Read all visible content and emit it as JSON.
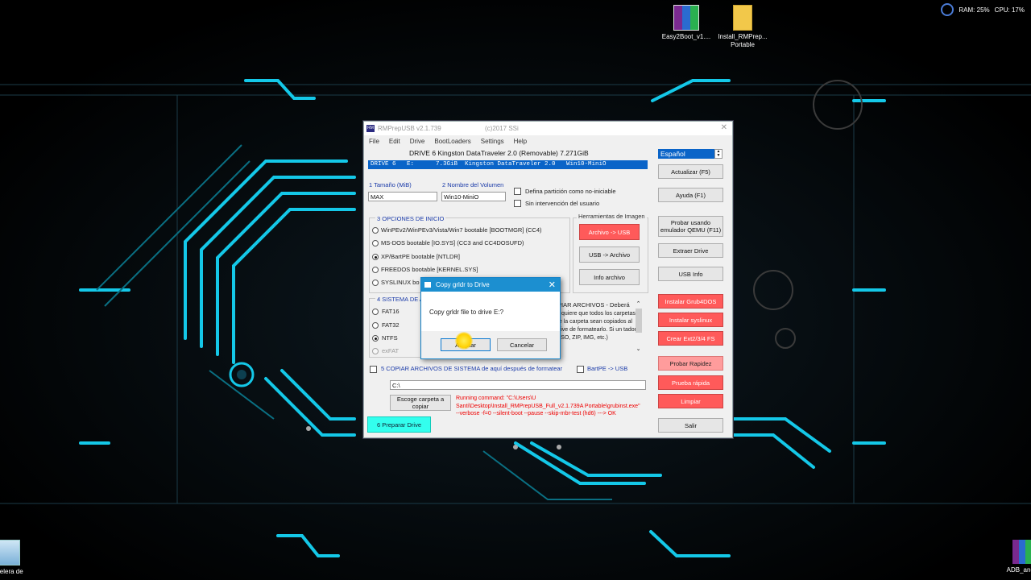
{
  "desktop": {
    "icons": [
      {
        "label": "Easy2Boot_v1...."
      },
      {
        "label": "Install_RMPrep... Portable"
      },
      {
        "label": "pelera de"
      },
      {
        "label": "ADB_and_"
      }
    ],
    "sysmon": {
      "ram": "RAM: 25%",
      "cpu": "CPU: 17%"
    }
  },
  "window": {
    "title": "RMPrepUSB v2.1.739",
    "copyright": "(c)2017 SSi",
    "menu": [
      "File",
      "Edit",
      "Drive",
      "BootLoaders",
      "Settings",
      "Help"
    ],
    "drive_title": "DRIVE 6 Kingston DataTraveler 2.0  (Removable) 7.271GiB",
    "drive_row": "DRIVE 6   E:      7.3GiB  Kingston DataTraveler 2.0   Win10-MiniO",
    "language": "Español",
    "size_label": "1 Tamaño (MiB)",
    "size_value": "MAX",
    "volname_label": "2 Nombre del Volumen",
    "volname_value": "Win10-MiniO",
    "chk_partition": "Defina partición como no-iniciable",
    "chk_nouser": "Sin intervención del usuario",
    "boot_options_label": "3 OPCIONES DE INICIO",
    "boot_options": [
      "WinPEv2/WinPEv3/Vista/Win7 bootable [BOOTMGR] (CC4)",
      "MS-DOS bootable [IO.SYS]   (CC3 and CC4DOSUFD)",
      "XP/BartPE bootable [NTLDR]",
      "FREEDOS bootable [KERNEL.SYS]",
      "SYSLINUX bo"
    ],
    "fs_label": "4 SISTEMA DE A",
    "fs_options": [
      "FAT16",
      "FAT32",
      "NTFS",
      "exFAT"
    ],
    "tools_label": "Herramientas de Imagen",
    "tools": [
      "Archivo -> USB",
      "USB -> Archivo",
      "Info archivo"
    ],
    "desc_header": "PIAR ARCHIVOS - Deberá",
    "desc_text": "si quiere que todos los carpetas de la carpeta sean copiados al drive de formatearlo. Si un tador (.ISO, ZIP, IMG, etc.)",
    "copy_label": "5 COPIAR ARCHIVOS DE SISTEMA de aquí después de formatear",
    "bartpe_label": "BartPE -> USB",
    "path_value": "C:\\",
    "choose_folder": "Escoge carpeta a copiar",
    "log": "Running command: \"C:\\Users\\U Santi\\Desktop\\Install_RMPrepUSB_Full_v2.1.739A Portable\\grubinst.exe\" --verbose -f=0 --silent-boot --pause --skip-mbr-test (hd6) ---> OK",
    "prepare": "6 Preparar Drive",
    "right_buttons": [
      "Actualizar (F5)",
      "Ayuda (F1)",
      "Probar usando emulador QEMU (F11)",
      "Extraer Drive",
      "USB Info"
    ],
    "grub_buttons": [
      "Instalar Grub4DOS",
      "Instalar syslinux",
      "Crear Ext2/3/4 FS"
    ],
    "test_buttons": [
      "Probar Rapidez",
      "Prueba rápida",
      "Limpiar"
    ],
    "exit": "Salir"
  },
  "dialog": {
    "title": "Copy grldr to Drive",
    "message": "Copy grldr file to drive E:?",
    "ok": "Aceptar",
    "cancel": "Cancelar"
  },
  "colors": {
    "accent": "#00e5ff",
    "selection": "#0a64c8",
    "red_button": "#ff5a5a"
  }
}
